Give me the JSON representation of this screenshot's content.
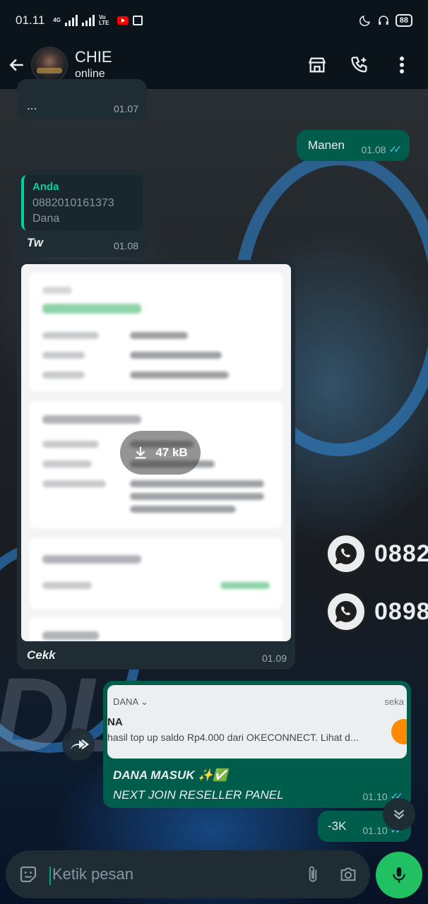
{
  "status_bar": {
    "time": "01.11",
    "network_4g": "4G",
    "volte": "Vo LTE",
    "battery": "88"
  },
  "header": {
    "name": "CHIE",
    "status": "online"
  },
  "messages": {
    "m1": {
      "text": "...",
      "time": "01.07"
    },
    "m2": {
      "text": "Manen",
      "time": "01.08"
    },
    "m3": {
      "quote_author": "Anda",
      "quote_line1": "0882010161373",
      "quote_line2": "Dana",
      "text": "Tw",
      "time": "01.08"
    },
    "m4": {
      "file_size": "47 kB",
      "caption": "Cekk",
      "time": "01.09"
    },
    "m5": {
      "preview_app": "DANA",
      "preview_time": "seka",
      "preview_title": "NA",
      "preview_text": "hasil top up saldo Rp4.000 dari OKECONNECT. Lihat d...",
      "line1": "DANA MASUK ✨✅",
      "line2": "NEXT JOIN RESELLER PANEL",
      "time": "01.10"
    },
    "m6": {
      "text": "-3K",
      "time": "01.10"
    }
  },
  "input": {
    "placeholder": "Ketik pesan"
  },
  "wallpaper_text": {
    "big": "DL",
    "phone1": "0882",
    "phone2": "0898"
  }
}
